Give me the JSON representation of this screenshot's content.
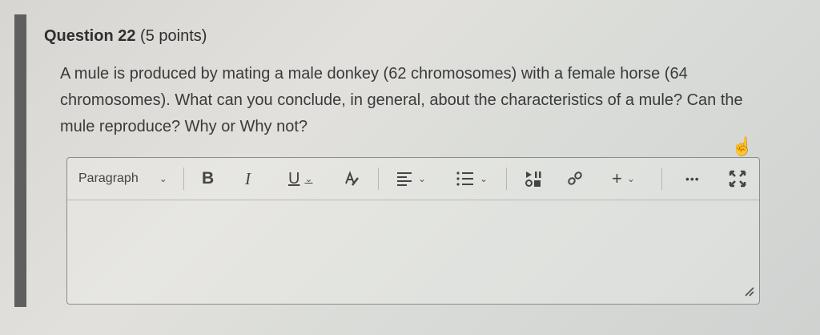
{
  "question": {
    "number_label": "Question 22",
    "points_label": "(5 points)",
    "text": "A mule is produced by mating a male donkey (62 chromosomes) with a female horse (64 chromosomes). What can you conclude, in general, about the characteristics of a mule? Can the mule reproduce? Why or Why not?"
  },
  "toolbar": {
    "paragraph_label": "Paragraph",
    "bold_label": "B",
    "italic_label": "I",
    "underline_label": "U",
    "more_label": "•••"
  },
  "editor": {
    "value": ""
  },
  "icons": {
    "paragraph_dropdown": "chevron-down-icon",
    "text_color": "text-color-icon",
    "align": "align-icon",
    "list": "list-icon",
    "insert_media": "insert-media-icon",
    "link": "link-icon",
    "insert": "plus-icon",
    "fullscreen": "fullscreen-icon",
    "resize": "resize-handle-icon",
    "cursor": "hand-cursor-icon"
  }
}
